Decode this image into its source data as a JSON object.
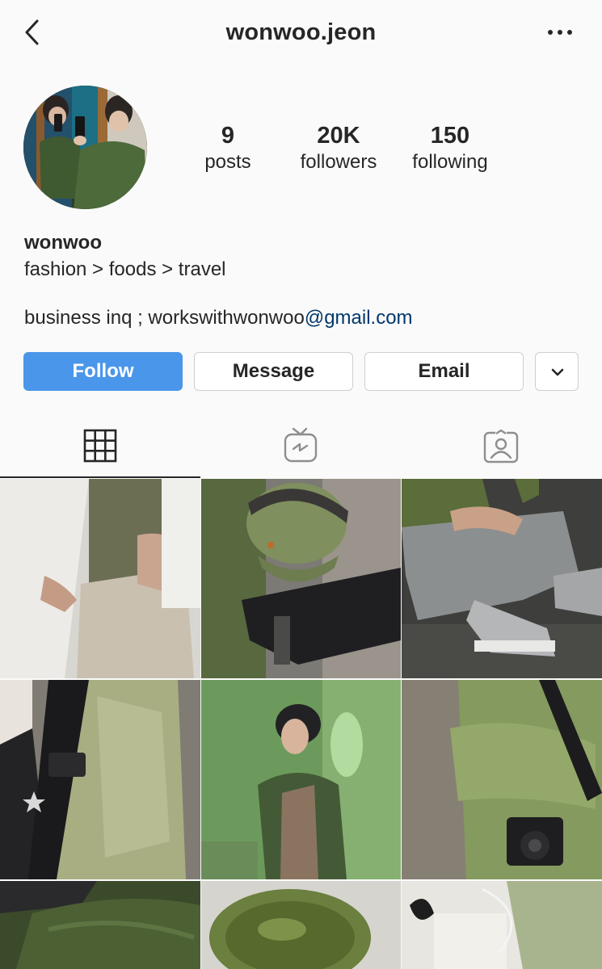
{
  "nav": {
    "title": "wonwoo.jeon",
    "back_icon": "chevron-left-icon",
    "more_icon": "more-horizontal-icon"
  },
  "profile": {
    "username": "wonwoo.jeon",
    "stats": [
      {
        "value": "9",
        "label": "posts"
      },
      {
        "value": "20K",
        "label": "followers"
      },
      {
        "value": "150",
        "label": "following"
      }
    ],
    "bio": {
      "name": "wonwoo",
      "line1": "fashion > foods > travel",
      "business_prefix": "business inq ; workswithwonwoo",
      "business_link": "@gmail.com"
    }
  },
  "actions": {
    "follow": "Follow",
    "message": "Message",
    "email": "Email",
    "more_icon": "chevron-down-icon"
  },
  "tabs": [
    {
      "icon": "grid-icon",
      "active": true
    },
    {
      "icon": "igtv-icon",
      "active": false
    },
    {
      "icon": "tagged-user-icon",
      "active": false
    }
  ],
  "colors": {
    "follow_button": "#4a96ea",
    "link": "#00376b",
    "text": "#262626",
    "background": "#fafafa"
  },
  "posts_visible": 9
}
